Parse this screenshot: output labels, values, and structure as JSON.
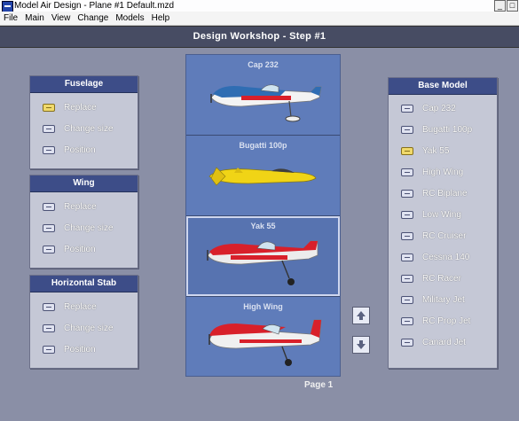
{
  "window": {
    "title": "Model Air Design - Plane #1  Default.mzd"
  },
  "menu": [
    "File",
    "Main",
    "View",
    "Change",
    "Models",
    "Help"
  ],
  "header": {
    "title": "Design Workshop  -  Step #1"
  },
  "fuselage": {
    "title": "Fuselage",
    "items": [
      "Replace",
      "Change size",
      "Position"
    ],
    "selected": 0
  },
  "wing": {
    "title": "Wing",
    "items": [
      "Replace",
      "Change size",
      "Position"
    ]
  },
  "stab": {
    "title": "Horizontal Stab",
    "items": [
      "Replace",
      "Change size",
      "Position"
    ]
  },
  "base_model": {
    "title": "Base Model",
    "items": [
      "Cap 232",
      "Bugatti 100p",
      "Yak 55",
      "High Wing",
      "RC Biplane",
      "Low Wing",
      "RC Cruiser",
      "Cessna 140",
      "RC Racer",
      "Military Jet",
      "RC Prop Jet",
      "Canard Jet"
    ],
    "selected": 2
  },
  "preview": {
    "planes": [
      "Cap 232",
      "Bugatti 100p",
      "Yak 55",
      "High Wing"
    ],
    "selected": 2
  },
  "pager": {
    "label": "Page 1"
  },
  "icons": {
    "up": "arrow-up-icon",
    "down": "arrow-down-icon"
  }
}
